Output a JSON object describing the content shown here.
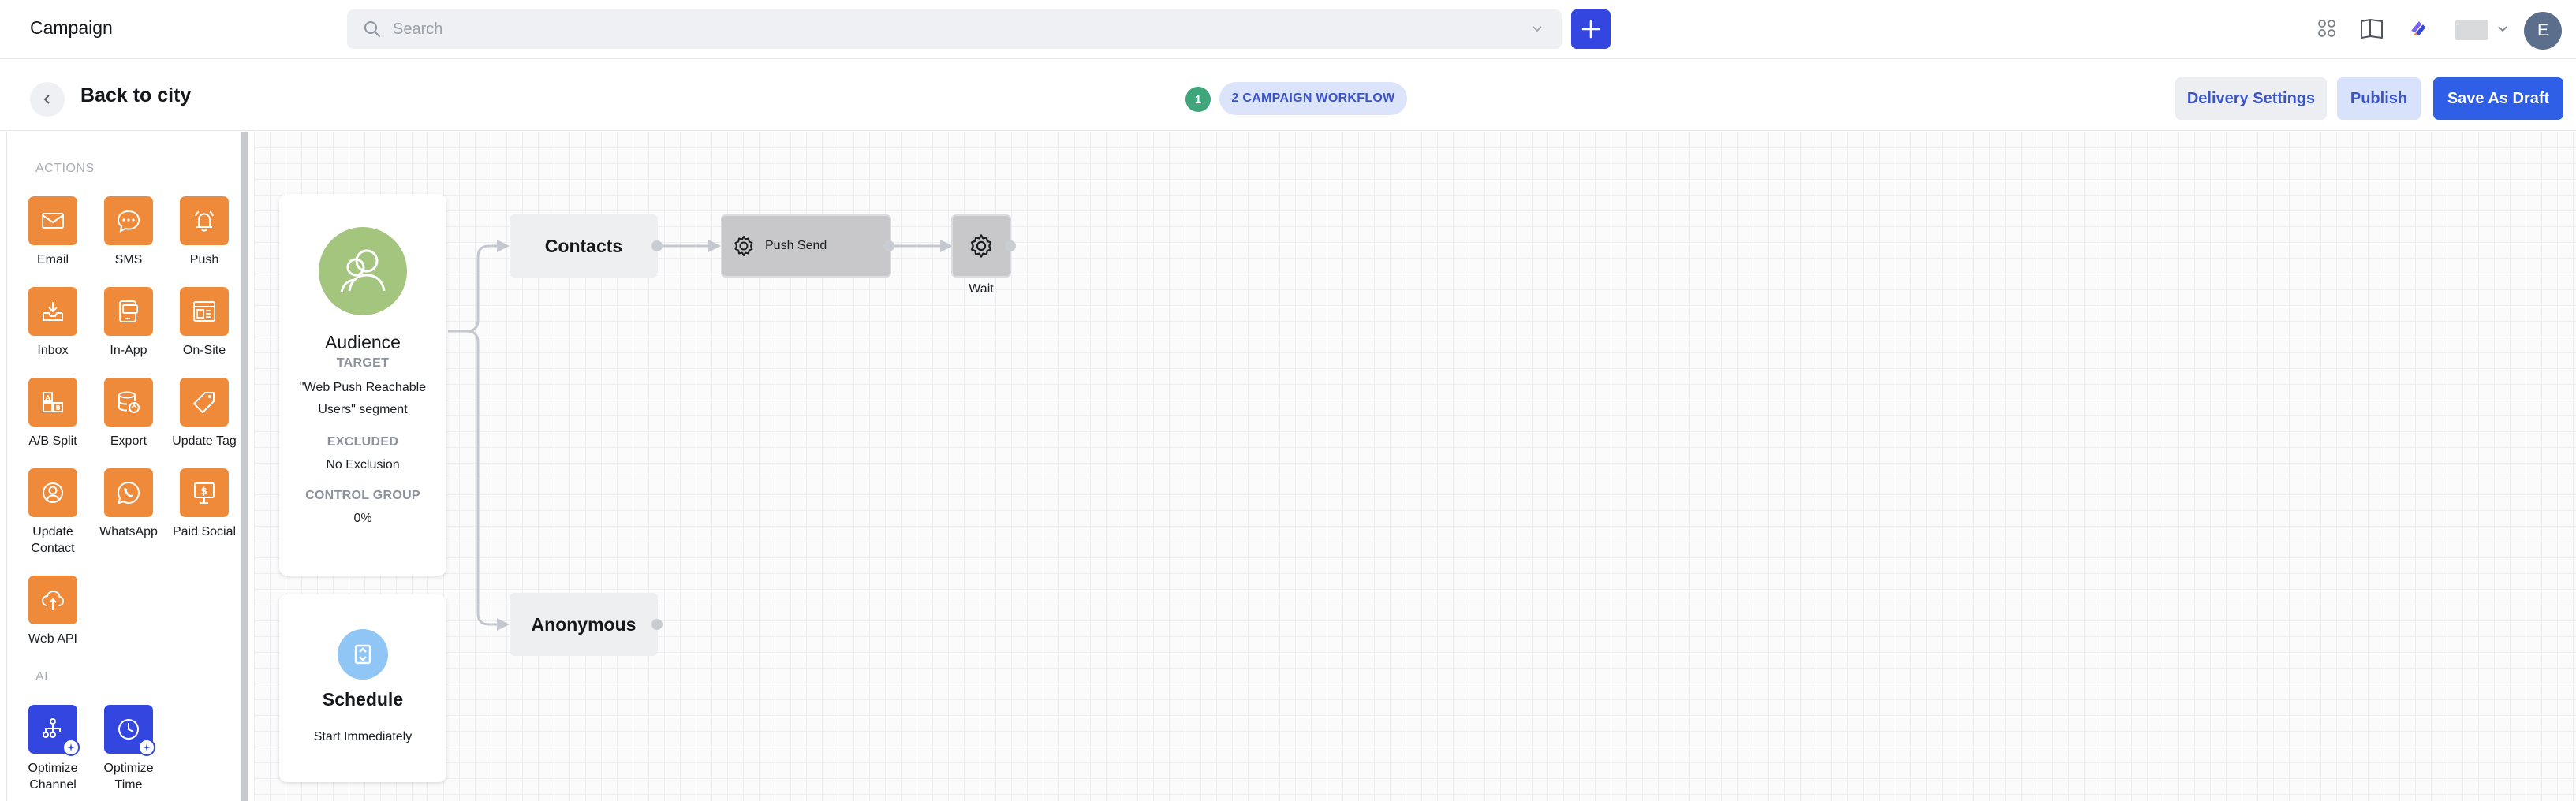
{
  "header": {
    "app_title": "Campaign",
    "search_placeholder": "Search",
    "avatar_initial": "E"
  },
  "subheader": {
    "back_label": "Back to city",
    "step_number": "1",
    "step_label": "2 CAMPAIGN WORKFLOW",
    "delivery_settings_label": "Delivery Settings",
    "publish_label": "Publish",
    "save_draft_label": "Save As Draft"
  },
  "palette": {
    "actions_label": "ACTIONS",
    "actions": [
      {
        "label": "Email",
        "icon": "email-icon"
      },
      {
        "label": "SMS",
        "icon": "sms-icon"
      },
      {
        "label": "Push",
        "icon": "push-icon"
      },
      {
        "label": "Inbox",
        "icon": "inbox-icon"
      },
      {
        "label": "In-App",
        "icon": "in-app-icon"
      },
      {
        "label": "On-Site",
        "icon": "on-site-icon"
      },
      {
        "label": "A/B Split",
        "icon": "ab-split-icon"
      },
      {
        "label": "Export",
        "icon": "export-icon"
      },
      {
        "label": "Update Tag",
        "icon": "tag-icon"
      },
      {
        "label": "Update Contact",
        "icon": "contact-icon"
      },
      {
        "label": "WhatsApp",
        "icon": "whatsapp-icon"
      },
      {
        "label": "Paid Social",
        "icon": "paid-social-icon"
      },
      {
        "label": "Web API",
        "icon": "web-api-icon"
      }
    ],
    "ai_label": "AI",
    "ai_actions": [
      {
        "label": "Optimize Channel",
        "icon": "optimize-channel-icon"
      },
      {
        "label": "Optimize Time",
        "icon": "optimize-time-icon"
      }
    ]
  },
  "canvas": {
    "audience": {
      "title": "Audience",
      "target_label": "TARGET",
      "target_value": "\"Web Push Reachable Users\" segment",
      "excluded_label": "EXCLUDED",
      "excluded_value": "No Exclusion",
      "control_label": "CONTROL GROUP",
      "control_value": "0%"
    },
    "schedule": {
      "title": "Schedule",
      "value": "Start Immediately"
    },
    "nodes": {
      "contacts": "Contacts",
      "anonymous": "Anonymous",
      "push_send": "Push Send",
      "wait": "Wait"
    }
  },
  "colors": {
    "primary": "#3346e0",
    "action_tile": "#f08a3b",
    "save_draft": "#2f5fe6",
    "audience_avatar": "#a3c57e",
    "schedule_icon": "#8fc6f5",
    "step_dot": "#3fa57a"
  }
}
